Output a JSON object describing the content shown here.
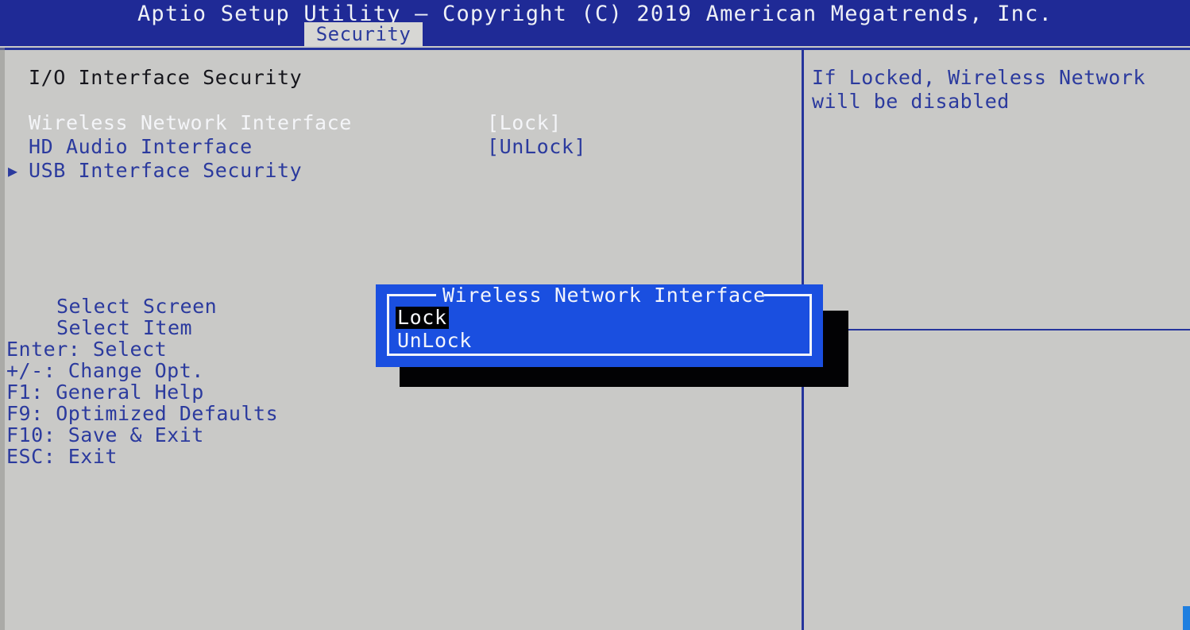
{
  "header": {
    "title": "Aptio Setup Utility – Copyright (C) 2019 American Megatrends, Inc.",
    "active_tab": "Security"
  },
  "colors": {
    "header_band": "#1f2a96",
    "screen_background": "#c9c9c7",
    "text_blue": "#2b3a9e",
    "text_white": "#f2f4fb",
    "popup_background": "#1a4fe0",
    "popup_shadow": "#020204",
    "highlight_background": "#000003"
  },
  "left_panel": {
    "section_heading": "I/O Interface Security",
    "settings": [
      {
        "arrow": "",
        "label": "Wireless Network Interface",
        "value": "[Lock]",
        "selected": true
      },
      {
        "arrow": "",
        "label": "HD Audio Interface",
        "value": "[UnLock]",
        "selected": false
      },
      {
        "arrow": "▶",
        "label": "USB Interface Security",
        "value": "",
        "selected": false
      }
    ]
  },
  "right_panel": {
    "help_text": "If Locked, Wireless Network\nwill be disabled",
    "key_legend": [
      {
        "text": "Select Screen",
        "indented": true
      },
      {
        "text": "Select Item",
        "indented": true
      },
      {
        "text": "Enter: Select",
        "indented": false
      },
      {
        "text": "+/-: Change Opt.",
        "indented": false
      },
      {
        "text": "F1: General Help",
        "indented": false
      },
      {
        "text": "F9: Optimized Defaults",
        "indented": false
      },
      {
        "text": "F10: Save & Exit",
        "indented": false
      },
      {
        "text": "ESC: Exit",
        "indented": false
      }
    ]
  },
  "popup": {
    "title": "Wireless Network Interface",
    "options": [
      {
        "label": "Lock",
        "selected": true
      },
      {
        "label": "UnLock",
        "selected": false
      }
    ]
  }
}
